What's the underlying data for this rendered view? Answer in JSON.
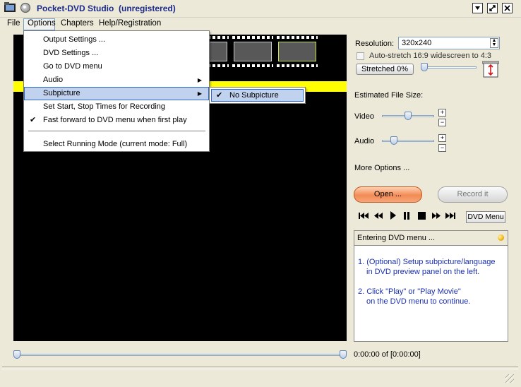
{
  "window": {
    "title": "Pocket-DVD Studio",
    "title_suffix": "(unregistered)"
  },
  "menubar": {
    "items": [
      {
        "label": "File"
      },
      {
        "label": "Options"
      },
      {
        "label": "Chapters"
      },
      {
        "label": "Help/Registration"
      }
    ]
  },
  "options_menu": {
    "items": [
      {
        "label": "Output Settings ...",
        "checked": false,
        "submenu": false
      },
      {
        "label": "DVD Settings ...",
        "checked": false,
        "submenu": false
      },
      {
        "label": "Go to DVD menu",
        "checked": false,
        "submenu": false
      },
      {
        "label": "Audio",
        "checked": false,
        "submenu": true
      },
      {
        "label": "Subpicture",
        "checked": false,
        "submenu": true,
        "highlighted": true
      },
      {
        "label": "Set Start, Stop Times for Recording",
        "checked": false,
        "submenu": false
      },
      {
        "label": "Fast forward to DVD menu when first play",
        "checked": true,
        "submenu": false
      },
      {
        "label": "Select Running Mode (current mode: Full)",
        "checked": false,
        "submenu": false
      }
    ]
  },
  "subpicture_submenu": {
    "items": [
      {
        "label": "No Subpicture",
        "checked": true
      }
    ]
  },
  "settings": {
    "resolution_label": "Resolution:",
    "resolution_value": "320x240",
    "autostretch_label": "Auto-stretch 16:9 widescreen to 4:3",
    "autostretch_checked": false,
    "stretched_label": "Stretched 0%",
    "stretch_level_percent": 0,
    "estimated_label": "Estimated File Size:",
    "video_label": "Video",
    "audio_label": "Audio",
    "video_quality_fraction": 0.5,
    "audio_quality_fraction": 0.2,
    "more_options_label": "More Options ..."
  },
  "actions": {
    "open_label": "Open ...",
    "record_label": "Record it",
    "dvd_menu_label": "DVD Menu"
  },
  "playback": {
    "buttons": [
      "first-icon",
      "rewind-icon",
      "play-icon",
      "pause-icon",
      "stop-icon",
      "forward-icon",
      "last-icon"
    ]
  },
  "status": {
    "title": "Entering DVD menu ...",
    "line1a": "1. (Optional) Setup subpicture/language",
    "line1b": "in DVD preview panel on the left.",
    "line2a": "2. Click \"Play\" or \"Play Movie\"",
    "line2b": "on the DVD menu to continue."
  },
  "timeline": {
    "time_label": "0:00:00 of [0:00:00]"
  },
  "colors": {
    "accent_highlight": "#c1d2ee",
    "status_text": "#1a2fb0",
    "video_banner": "#ffff00",
    "open_button": "#f28b55"
  }
}
